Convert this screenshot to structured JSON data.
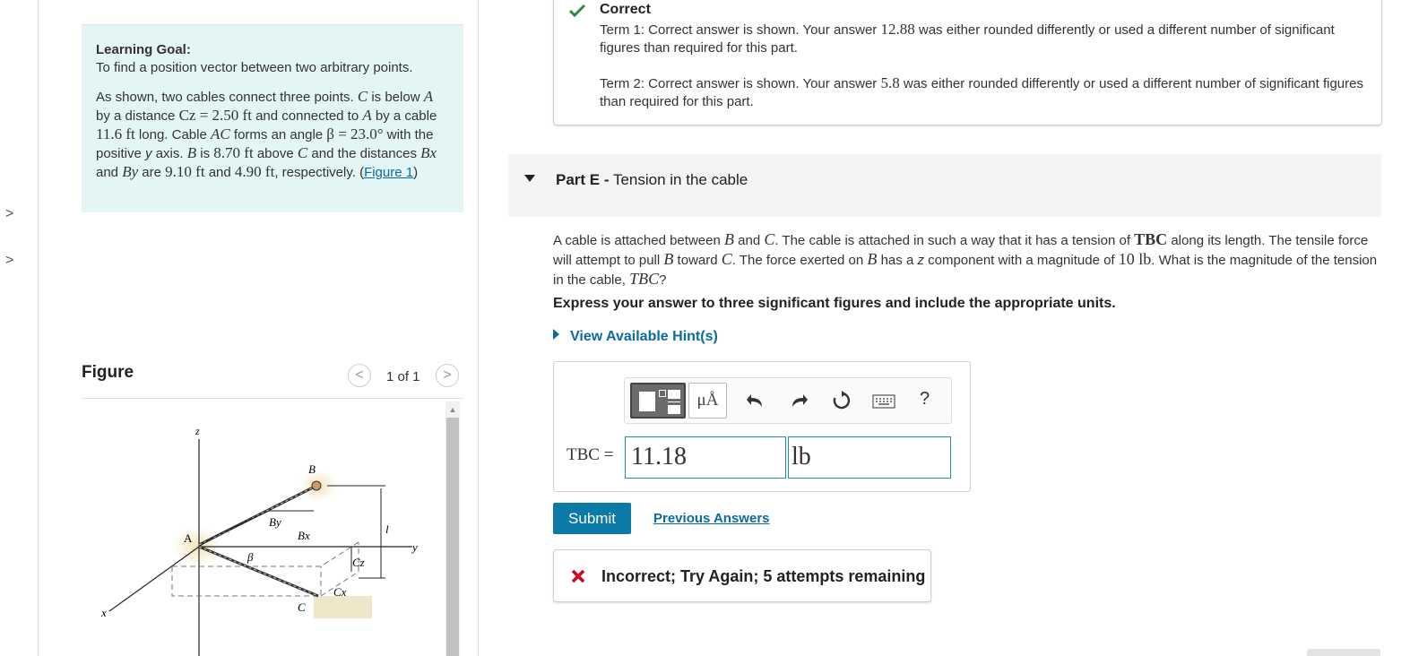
{
  "nav": {
    "expand_1": ">",
    "expand_2": ">"
  },
  "learning_goal": {
    "title": "Learning Goal:",
    "intro": "To find a position vector between two arbitrary points.",
    "s1": "As shown, two cables connect three points. ",
    "m_C": "C",
    "s2": " is below ",
    "m_A": "A",
    "s3": " by a distance ",
    "m_Cz": "Cz = 2.50 ft",
    "s4": " and connected to ",
    "s5": " by a cable ",
    "m_len": "11.6 ft",
    "s6": " long. Cable ",
    "m_AC": "AC",
    "s7": " forms an angle ",
    "m_beta": "β = 23.0°",
    "s8": " with the positive ",
    "s8y": "y",
    "s8b": " axis. ",
    "m_B": "B",
    "s9": " is ",
    "m_870": "8.70 ft",
    "s10": " above ",
    "s11": " and the distances ",
    "m_Bx": "Bx",
    "s12": " and ",
    "m_By": "By",
    "s13": " are ",
    "m_910": "9.10 ft",
    "s14": " and ",
    "m_490": "4.90 ft",
    "s15": ", respectively. (",
    "figure_link": "Figure 1",
    "s16": ")"
  },
  "figure": {
    "title": "Figure",
    "prev": "<",
    "next": ">",
    "count": "1 of 1",
    "labels": {
      "z": "z",
      "y": "y",
      "x": "x",
      "A": "A",
      "B": "B",
      "C": "C",
      "By": "By",
      "Bx": "Bx",
      "beta": "β",
      "Cz": "Cz",
      "Cx": "Cx",
      "l": "l"
    }
  },
  "feedback_correct": {
    "title": "Correct",
    "t1_a": "Term 1: Correct answer is shown. Your answer ",
    "t1_val": "12.88",
    "t1_b": " was either rounded differently or used a different number of significant figures than required for this part.",
    "t2_a": "Term 2: Correct answer is shown. Your answer ",
    "t2_val": "5.8",
    "t2_b": " was either rounded differently or used a different number of significant figures than required for this part."
  },
  "partE": {
    "label": "Part E -",
    "title": "Tension in the cable",
    "q1": "A cable is attached between ",
    "B": "B",
    "q2": " and ",
    "C": "C",
    "q3": ". The cable is attached in such a way that it has a tension of ",
    "TBC": "TBC",
    "q4": " along its length. The tensile force will attempt to pull ",
    "q5": " toward ",
    "q6": ". The force exerted on ",
    "q7": " has a ",
    "z": "z",
    "q8": " component with a magnitude of ",
    "force": "10 lb",
    "q9": ". What is the magnitude of the tension in the cable, ",
    "q10": "?",
    "instruction": "Express your answer to three significant figures and include the appropriate units.",
    "hints": "View Available Hint(s)"
  },
  "answer": {
    "label": "TBC =",
    "value": "11.18",
    "unit": "lb",
    "tool_units": "μÅ",
    "help": "?"
  },
  "actions": {
    "submit": "Submit",
    "previous_answers": "Previous Answers"
  },
  "feedback_incorrect": {
    "text": "Incorrect; Try Again; 5 attempts remaining"
  },
  "colors": {
    "accent": "#0b7aa6",
    "correct": "#2a8a3e",
    "incorrect": "#d0021b",
    "goal_bg": "#e4f5f5"
  },
  "icons": [
    "chevron-right-icon",
    "checkmark-icon",
    "triangle-down-icon",
    "undo-icon",
    "redo-icon",
    "reset-icon",
    "keyboard-icon",
    "help-icon",
    "x-mark-icon",
    "templates-icon"
  ]
}
